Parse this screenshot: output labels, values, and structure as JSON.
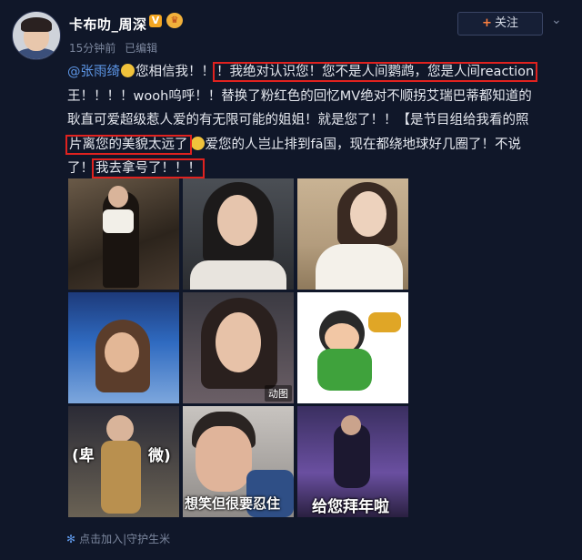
{
  "header": {
    "username": "卡布叻_周深",
    "verified_mark": "V",
    "time": "15分钟前",
    "edited": "已编辑",
    "follow_plus": "+",
    "follow_label": "关注",
    "chevron": "⌄"
  },
  "post": {
    "line1": {
      "mention": "@张雨绮",
      "mid": "您相信我！！",
      "boxed": "！我绝对认识您！您不是人间鹦鹉，您是人间reaction"
    },
    "line2": "王！！！！wooh呜呼！！替换了粉红色的回忆MV绝对不顺拐艾瑞巴蒂都知道的",
    "line3": "耿直可爱超级惹人爱的有无限可能的姐姐！就是您了！！【是节目组给我看的照",
    "line4": {
      "boxed": "片离您的美貌太远了",
      "rest": "爱您的人岂止排到fā国，现在都绕地球好几圈了！不说"
    },
    "line5": {
      "start": "了！",
      "boxed": "我去拿号了！！！"
    }
  },
  "images": [
    {
      "caption": ""
    },
    {
      "caption": ""
    },
    {
      "caption": ""
    },
    {
      "caption": ""
    },
    {
      "caption": "",
      "tag": "动图"
    },
    {
      "caption": ""
    },
    {
      "caption_left": "(卑",
      "caption_right": "微)"
    },
    {
      "caption": "想笑但很要忍住"
    },
    {
      "caption": "给您拜年啦"
    }
  ],
  "footer": {
    "text": "点击加入|守护生米"
  },
  "colors": {
    "background": "#101729",
    "mention": "#5d96e6",
    "highlight_box": "#e0221f",
    "follow_plus": "#ff8140"
  }
}
